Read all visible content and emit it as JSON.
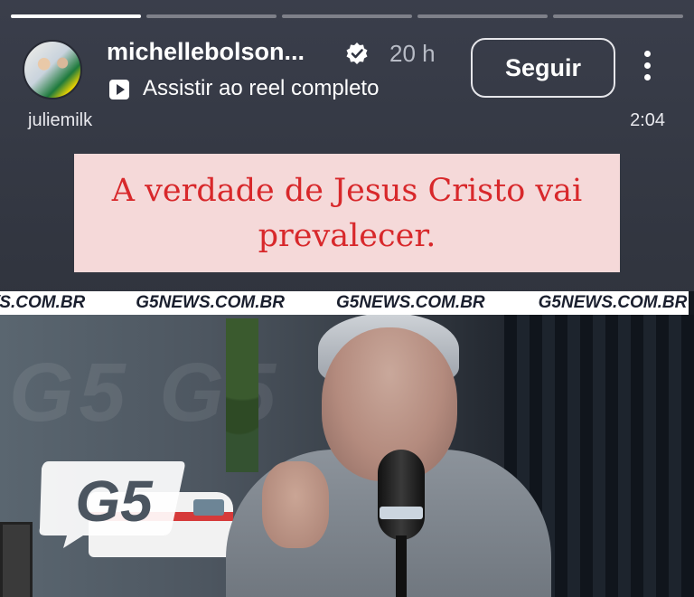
{
  "story": {
    "progress": [
      1.0,
      0.0,
      0.0,
      0.0,
      0.0
    ],
    "account": {
      "username": "michellebolson...",
      "verified": true,
      "time_ago": "20 h",
      "reel_link": "Assistir ao reel completo",
      "follow_label": "Seguir"
    },
    "audio_credit": "juliemilk",
    "duration": "2:04",
    "caption": "A verdade de Jesus Cristo vai prevalecer.",
    "video": {
      "ticker": [
        "/S.COM.BR",
        "G5NEWS.COM.BR",
        "G5NEWS.COM.BR",
        "G5NEWS.COM.BR"
      ],
      "logo_text": "G5",
      "watermark_text": "G5 G5"
    },
    "colors": {
      "caption_bg": "#f5d9d9",
      "caption_text": "#d8282b",
      "ticker_text": "#1a1f2e"
    },
    "icons": [
      "verified-badge-icon",
      "reel-play-icon",
      "more-options-icon"
    ]
  }
}
